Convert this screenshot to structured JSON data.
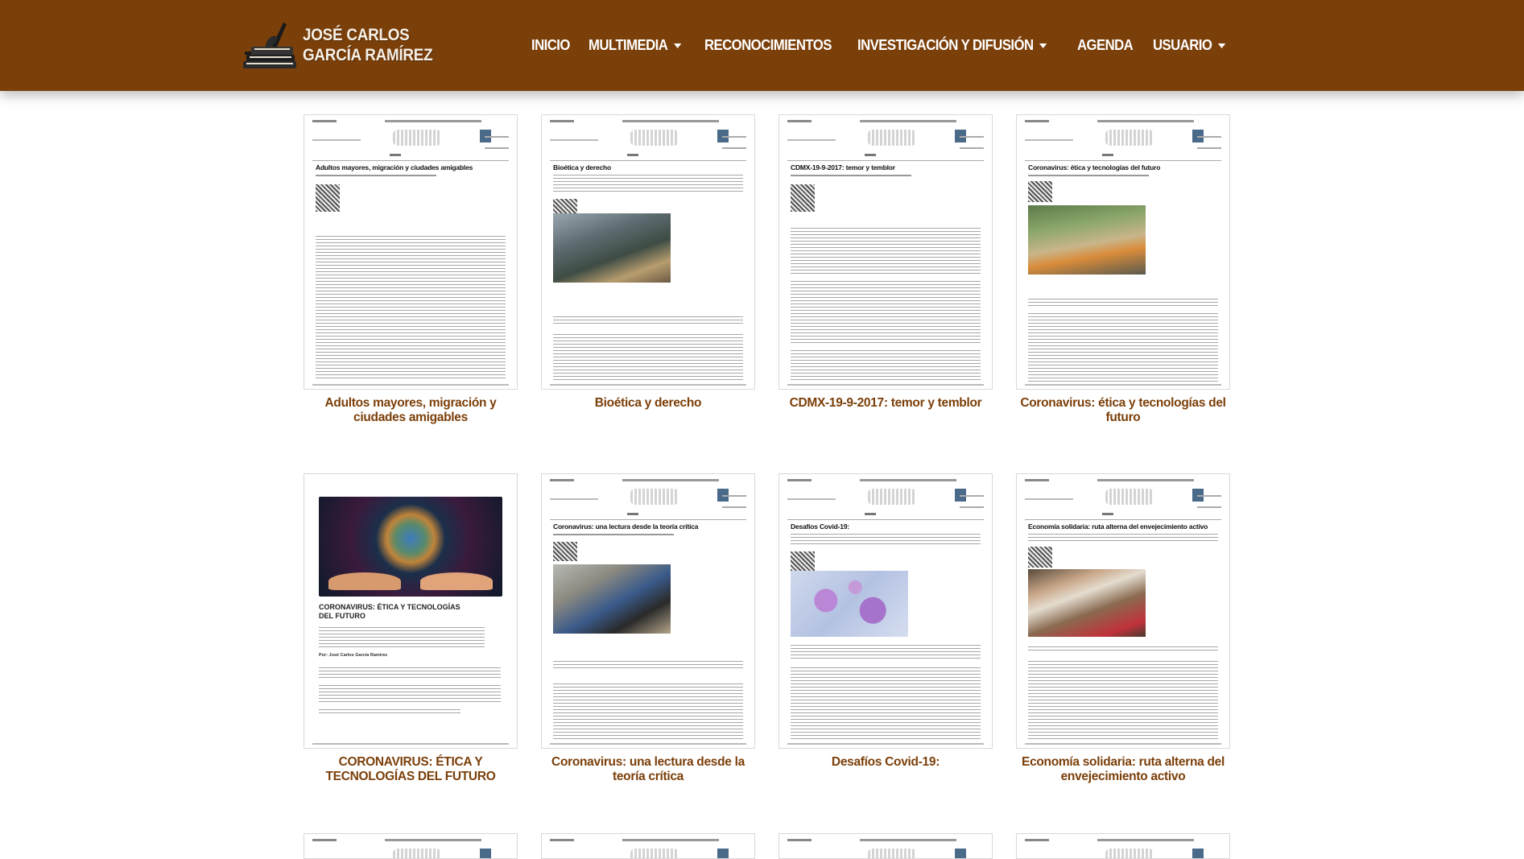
{
  "brand": {
    "line1": "JOSÉ CARLOS",
    "line2": "GARCÍA RAMÍREZ",
    "icon": "books-pen-icon"
  },
  "nav": {
    "items": [
      {
        "label": "INICIO",
        "dropdown": false
      },
      {
        "label": "MULTIMEDIA",
        "dropdown": true
      },
      {
        "label": "RECONOCIMIENTOS",
        "dropdown": false
      },
      {
        "label": "INVESTIGACIÓN Y DIFUSIÓN",
        "dropdown": true
      },
      {
        "label": "AGENDA",
        "dropdown": false
      },
      {
        "label": "USUARIO",
        "dropdown": true
      }
    ]
  },
  "articles": [
    {
      "caption": "Adultos mayores, migración y ciudades amigables",
      "doc_title": "Adultos mayores, migración y ciudades amigables"
    },
    {
      "caption": "Bioética y derecho",
      "doc_title": "Bioética y derecho"
    },
    {
      "caption": "CDMX-19-9-2017: temor y temblor",
      "doc_title": "CDMX-19-9-2017: temor y temblor"
    },
    {
      "caption": "Coronavirus: ética y tecnologías del futuro",
      "doc_title": "Coronavirus: ética y tecnologías del futuro"
    },
    {
      "caption": "CORONAVIRUS: ÉTICA Y TECNOLOGÍAS DEL FUTURO",
      "doc_title": "CORONAVIRUS: ÉTICA Y TECNOLOGÍAS DEL FUTURO",
      "doc_author": "Por: José Carlos García Ramírez"
    },
    {
      "caption": "Coronavirus: una lectura desde la teoría crítica",
      "doc_title": "Coronavirus: una lectura desde la teoría crítica"
    },
    {
      "caption": "Desafíos Covid-19:",
      "doc_title": "Desafíos Covid-19:"
    },
    {
      "caption": "Economía solidaria: ruta alterna del envejecimiento activo",
      "doc_title": "Economía solidaria: ruta alterna del envejecimiento activo"
    }
  ],
  "colors": {
    "navbar": "#7b3f09",
    "caption": "#7b3f09"
  }
}
